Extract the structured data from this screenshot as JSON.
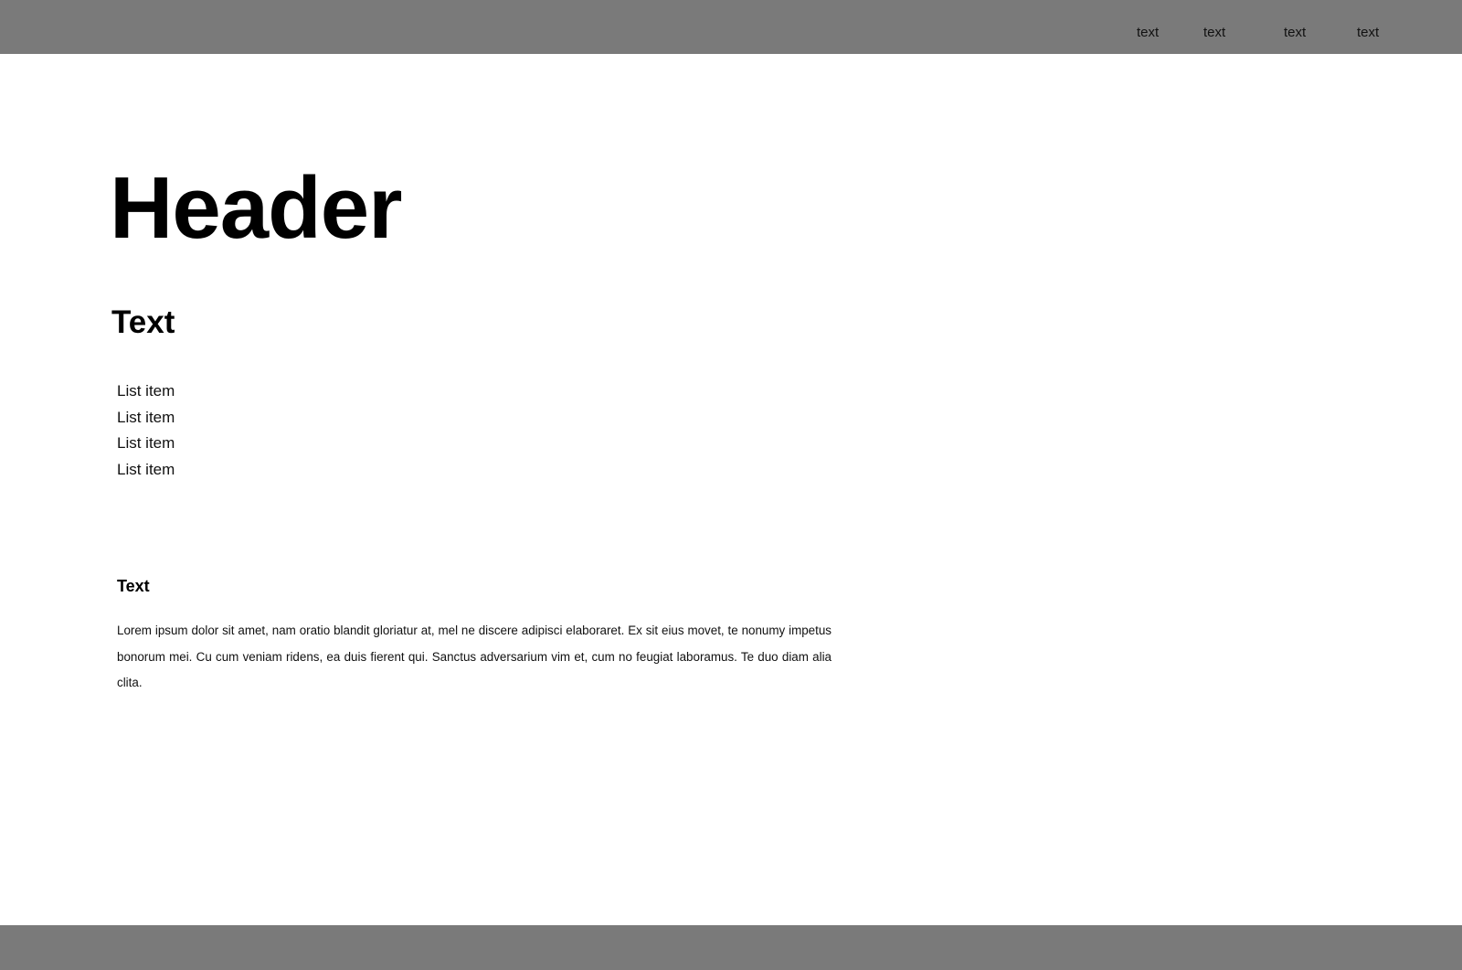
{
  "header": {
    "nav": [
      {
        "label": "text"
      },
      {
        "label": "text"
      },
      {
        "label": "text"
      },
      {
        "label": "text"
      }
    ]
  },
  "main": {
    "title": "Header",
    "section_title": "Text",
    "list": [
      {
        "label": "List item"
      },
      {
        "label": "List item"
      },
      {
        "label": "List item"
      },
      {
        "label": "List item"
      }
    ],
    "sub_title": "Text",
    "paragraph": "Lorem ipsum dolor sit amet, nam oratio blandit gloriatur at, mel ne discere adipisci elaboraret. Ex sit eius movet, te nonumy impetus bonorum mei. Cu cum veniam ridens, ea duis fierent qui. Sanctus adversarium vim et, cum no feugiat laboramus. Te duo diam alia clita."
  },
  "colors": {
    "bar_background": "#7a7a7a",
    "page_background": "#ffffff",
    "text": "#000000"
  }
}
